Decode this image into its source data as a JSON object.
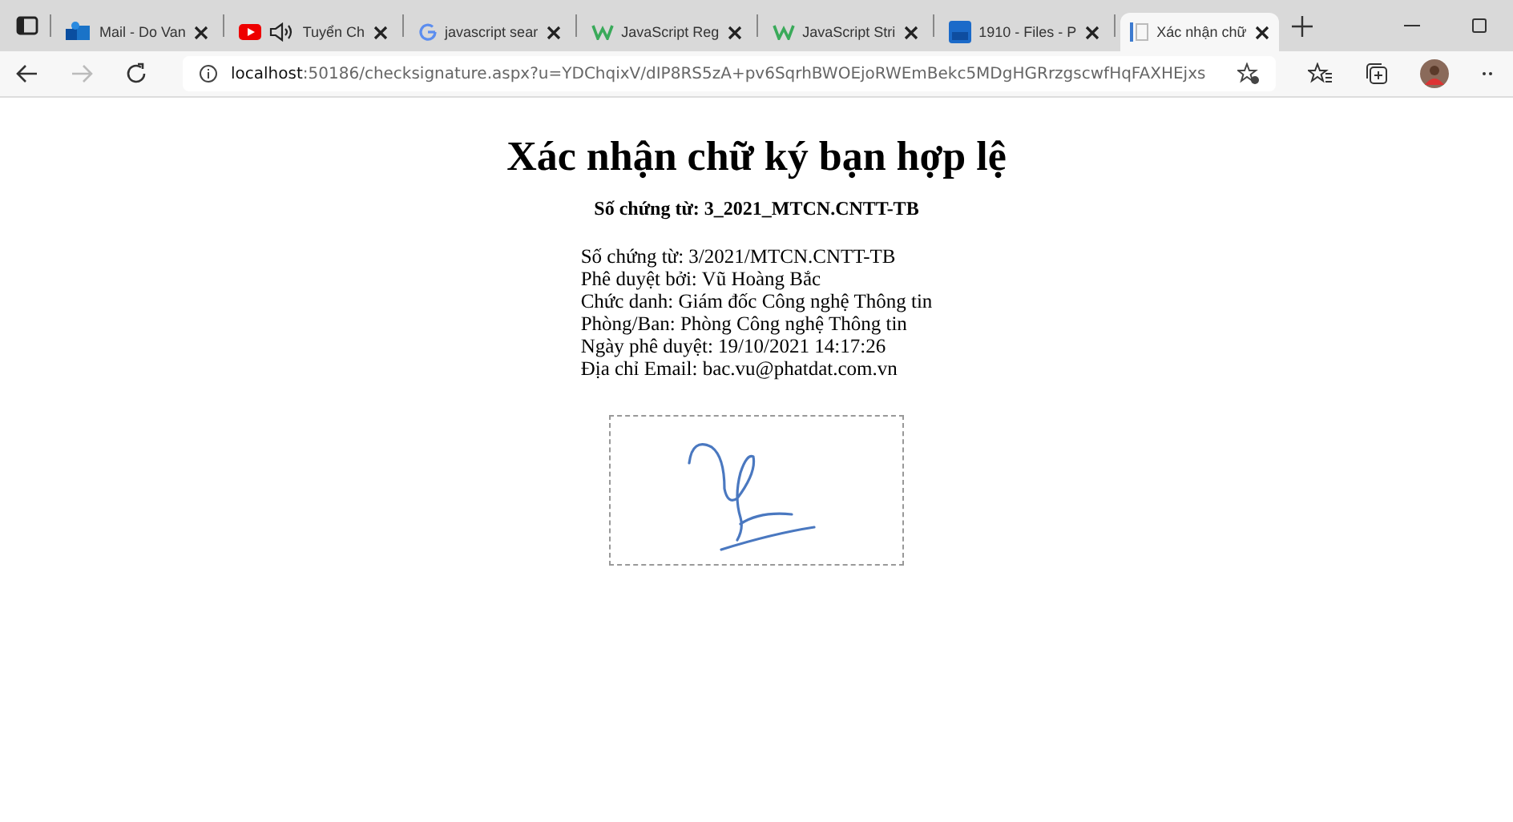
{
  "tabs": [
    {
      "label": "Mail - Do Van",
      "selected": false
    },
    {
      "label": "Tuyển Ch",
      "selected": false,
      "audio": true
    },
    {
      "label": "javascript sear",
      "selected": false
    },
    {
      "label": "JavaScript Reg",
      "selected": false
    },
    {
      "label": "JavaScript Stri",
      "selected": false
    },
    {
      "label": "1910 - Files - P",
      "selected": false
    },
    {
      "label": "Xác nhận chữ",
      "selected": true
    }
  ],
  "address_bar": {
    "host": "localhost",
    "rest": ":50186/checksignature.aspx?u=YDChqixV/dIP8RS5zA+pv6SqrhBWOEjoRWEmBekc5MDgHGRrzgscwfHqFAXHEjxs"
  },
  "page": {
    "title": "Xác nhận chữ ký bạn hợp lệ",
    "subtitle": "Số chứng từ: 3_2021_MTCN.CNTT-TB",
    "details": [
      "Số chứng từ: 3/2021/MTCN.CNTT-TB",
      "Phê duyệt bởi: Vũ Hoàng Bắc",
      "Chức danh: Giám đốc Công nghệ Thông tin",
      "Phòng/Ban: Phòng Công nghệ Thông tin",
      "Ngày phê duyệt: 19/10/2021 14:17:26",
      "Địa chỉ Email: bac.vu@phatdat.com.vn"
    ]
  }
}
